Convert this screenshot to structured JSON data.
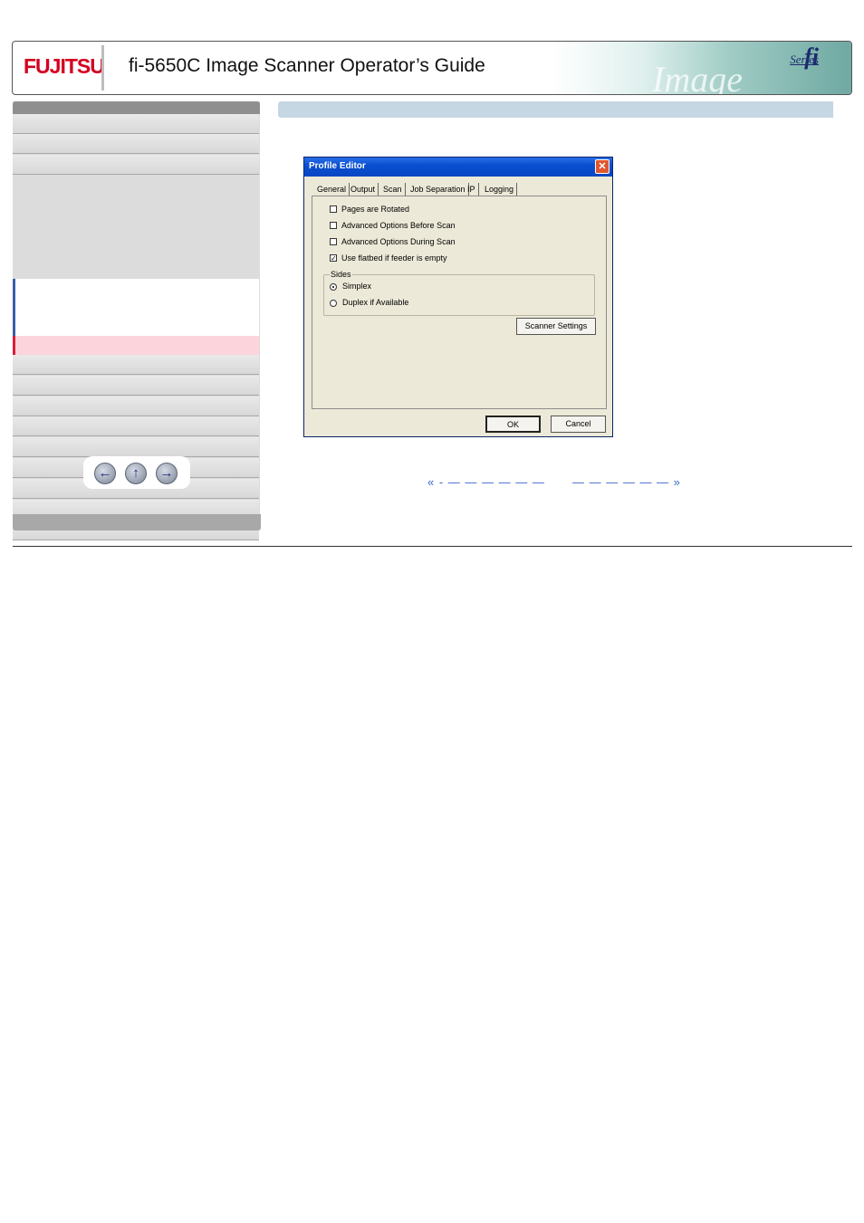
{
  "header": {
    "logo_text": "FUJITSU",
    "title": "fi-5650C Image Scanner Operator’s Guide",
    "brand_mark": "fi",
    "brand_series": "Series",
    "art_text": "Image Scanner"
  },
  "nav": {
    "back_icon": "arrow-left-icon",
    "up_icon": "arrow-up-icon",
    "forward_icon": "arrow-right-icon"
  },
  "dialog": {
    "title": "Profile Editor",
    "tabs": [
      "General",
      "Output",
      "Scan",
      "Job Separation",
      "IP",
      "Logging"
    ],
    "selected_tab": "Scan",
    "options": [
      {
        "label": "Pages are Rotated",
        "checked": false
      },
      {
        "label": "Advanced Options Before Scan",
        "checked": false
      },
      {
        "label": "Advanced Options During Scan",
        "checked": false
      },
      {
        "label": "Use flatbed if feeder is empty",
        "checked": true
      }
    ],
    "sides": {
      "title": "Sides",
      "options": [
        {
          "label": "Simplex",
          "selected": true
        },
        {
          "label": "Duplex if Available",
          "selected": false
        }
      ]
    },
    "scanner_settings_label": "Scanner Settings",
    "ok_label": "OK",
    "cancel_label": "Cancel"
  },
  "pager": {
    "prev": "« - — — — — — —",
    "next": "— — — — — — »"
  },
  "colors": {
    "fujitsu_red": "#d4001e",
    "active_nav": "#fcd4dc",
    "content_header": "#c6d7e4",
    "link_blue": "#3a66c9"
  }
}
